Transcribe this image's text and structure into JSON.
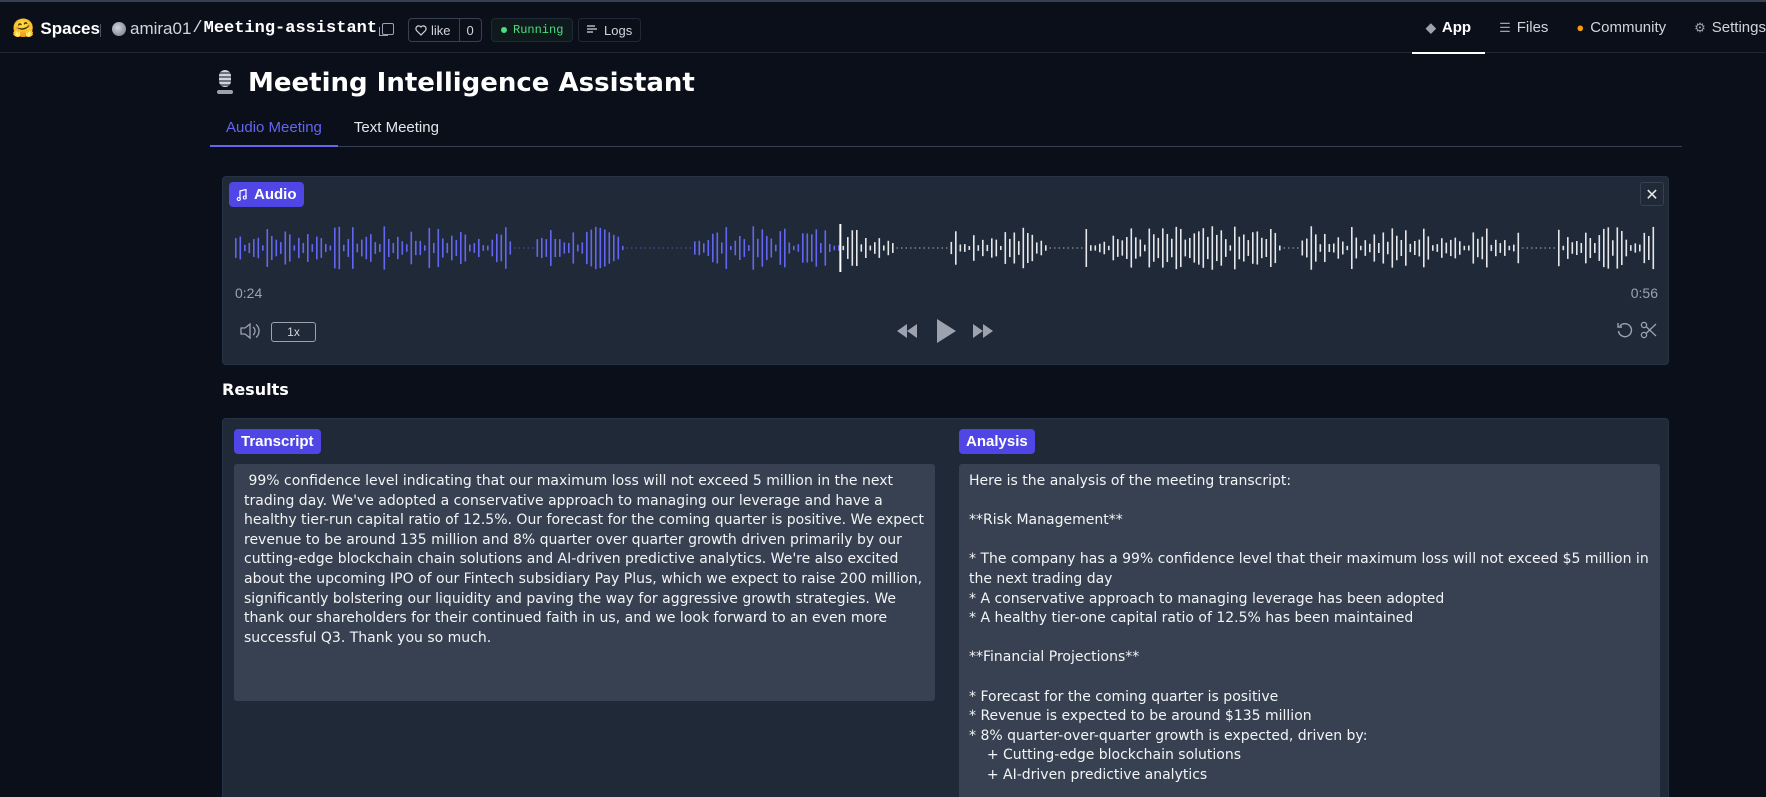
{
  "header": {
    "brand": "Spaces",
    "owner": "amira01",
    "repo_name": "Meeting-assistant",
    "like_label": "like",
    "like_count": "0",
    "status": "Running",
    "logs_label": "Logs",
    "nav": [
      {
        "label": "App",
        "icon": "cube-icon"
      },
      {
        "label": "Files",
        "icon": "files-icon"
      },
      {
        "label": "Community",
        "icon": "community-icon"
      },
      {
        "label": "Settings",
        "icon": "gear-icon"
      }
    ]
  },
  "app": {
    "title": "Meeting Intelligence Assistant",
    "tabs": [
      {
        "label": "Audio Meeting",
        "active": true
      },
      {
        "label": "Text Meeting",
        "active": false
      }
    ]
  },
  "audio": {
    "label": "Audio",
    "current_time": "0:24",
    "total_time": "0:56",
    "played_fraction": 0.425,
    "speed": "1x"
  },
  "results": {
    "heading": "Results",
    "transcript_label": "Transcript",
    "transcript_text": " 99% confidence level indicating that our maximum loss will not exceed 5 million in the next trading day. We've adopted a conservative approach to managing our leverage and have a healthy tier-run capital ratio of 12.5%. Our forecast for the coming quarter is positive. We expect revenue to be around 135 million and 8% quarter over quarter growth driven primarily by our cutting-edge blockchain chain solutions and AI-driven predictive analytics. We're also excited about the upcoming IPO of our Fintech subsidiary Pay Plus, which we expect to raise 200 million, significantly bolstering our liquidity and paving the way for aggressive growth strategies. We thank our shareholders for their continued faith in us, and we look forward to an even more successful Q3. Thank you so much.",
    "analysis_label": "Analysis",
    "analysis_text": "Here is the analysis of the meeting transcript:\n\n**Risk Management**\n\n* The company has a 99% confidence level that their maximum loss will not exceed $5 million in the next trading day\n* A conservative approach to managing leverage has been adopted\n* A healthy tier-one capital ratio of 12.5% has been maintained\n\n**Financial Projections**\n\n* Forecast for the coming quarter is positive\n* Revenue is expected to be around $135 million\n* 8% quarter-over-quarter growth is expected, driven by:\n    + Cutting-edge blockchain solutions\n    + AI-driven predictive analytics"
  },
  "colors": {
    "accent": "#6366f1",
    "badge": "#4f46e5",
    "status": "#4ade80",
    "background": "#0b0f19",
    "panel": "#1f2937"
  }
}
